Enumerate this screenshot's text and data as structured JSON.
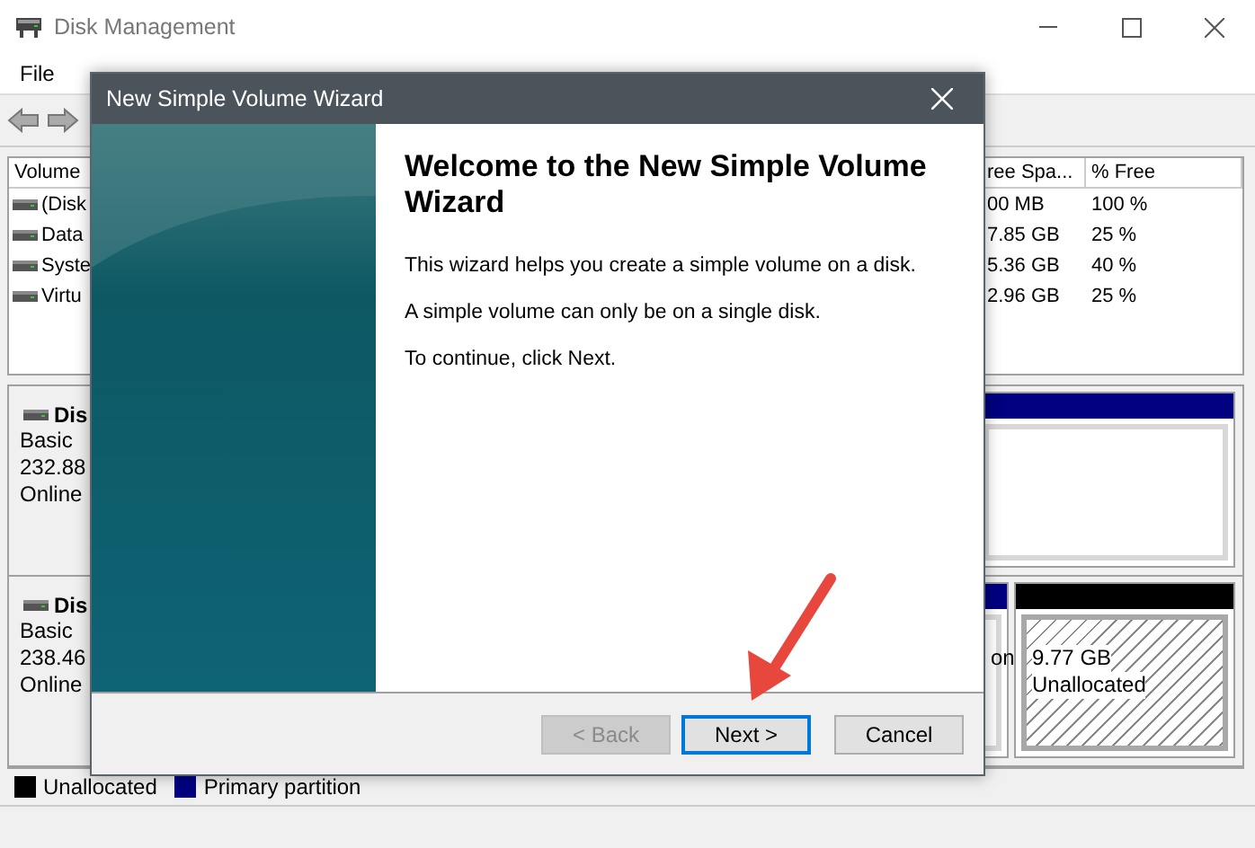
{
  "window": {
    "title": "Disk Management",
    "menu": [
      "File"
    ]
  },
  "volume_list": {
    "columns": [
      "Volume",
      "ree Spa...",
      "% Free"
    ],
    "rows": [
      {
        "cells": [
          "(Disk",
          "00 MB",
          "100 %"
        ]
      },
      {
        "cells": [
          "Data",
          "7.85 GB",
          "25 %"
        ]
      },
      {
        "cells": [
          "Syste",
          "5.36 GB",
          "40 %"
        ]
      },
      {
        "cells": [
          "Virtu",
          "2.96 GB",
          "25 %"
        ]
      }
    ]
  },
  "disks": [
    {
      "name": "Dis",
      "type": "Basic",
      "size": "232.88",
      "status": "Online",
      "partitions": [
        {
          "kind": "primary"
        }
      ]
    },
    {
      "name": "Dis",
      "type": "Basic",
      "size": "238.46",
      "status": "Online",
      "partitions": [
        {
          "kind": "primary",
          "lines": [
            "on"
          ]
        },
        {
          "kind": "unallocated",
          "lines": [
            "9.77 GB",
            "Unallocated"
          ]
        }
      ]
    }
  ],
  "legend": [
    {
      "label": "Unallocated",
      "color": "#000000"
    },
    {
      "label": "Primary partition",
      "color": "#000080"
    }
  ],
  "dialog": {
    "title": "New Simple Volume Wizard",
    "heading": "Welcome to the New Simple Volume Wizard",
    "paragraphs": [
      "This wizard helps you create a simple volume on a disk.",
      "A simple volume can only be on a single disk.",
      "To continue, click Next."
    ],
    "buttons": [
      {
        "label": "< Back",
        "disabled": true,
        "focused": false
      },
      {
        "label": "Next >",
        "disabled": false,
        "focused": true
      },
      {
        "label": "Cancel",
        "disabled": false,
        "focused": false
      }
    ]
  }
}
